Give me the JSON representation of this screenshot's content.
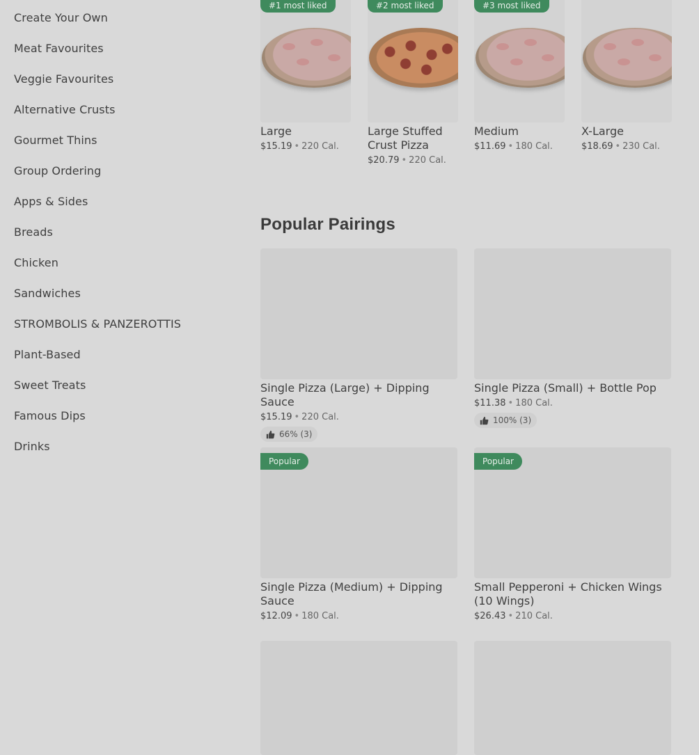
{
  "sidebar": {
    "items": [
      {
        "label": "Create Your Own"
      },
      {
        "label": "Meat Favourites"
      },
      {
        "label": "Veggie Favourites"
      },
      {
        "label": "Alternative Crusts"
      },
      {
        "label": "Gourmet Thins"
      },
      {
        "label": "Group Ordering"
      },
      {
        "label": "Apps & Sides"
      },
      {
        "label": "Breads"
      },
      {
        "label": "Chicken"
      },
      {
        "label": "Sandwiches"
      },
      {
        "label": "STROMBOLIS & PANZEROTTIS"
      },
      {
        "label": "Plant-Based"
      },
      {
        "label": "Sweet Treats"
      },
      {
        "label": "Famous Dips"
      },
      {
        "label": "Drinks"
      }
    ]
  },
  "carousel": {
    "items": [
      {
        "badge": "#1 most liked",
        "name": "Large",
        "price": "$15.19",
        "cal": "220 Cal."
      },
      {
        "badge": "#2 most liked",
        "name": "Large Stuffed Crust Pizza",
        "price": "$20.79",
        "cal": "220 Cal."
      },
      {
        "badge": "#3 most liked",
        "name": "Medium",
        "price": "$11.69",
        "cal": "180 Cal."
      },
      {
        "badge": "",
        "name": "X-Large",
        "price": "$18.69",
        "cal": "230 Cal."
      }
    ]
  },
  "pairings": {
    "title": "Popular Pairings",
    "items": [
      {
        "name": "Single Pizza (Large) + Dipping Sauce",
        "price": "$15.19",
        "cal": "220 Cal.",
        "likes": "66% (3)",
        "badge": ""
      },
      {
        "name": "Single Pizza (Small) + Bottle Pop",
        "price": "$11.38",
        "cal": "180 Cal.",
        "likes": "100% (3)",
        "badge": ""
      },
      {
        "name": "Single Pizza (Medium) + Dipping Sauce",
        "price": "$12.09",
        "cal": "180 Cal.",
        "likes": "",
        "badge": "Popular"
      },
      {
        "name": "Small Pepperoni + Chicken Wings (10 Wings)",
        "price": "$26.43",
        "cal": "210 Cal.",
        "likes": "",
        "badge": "Popular"
      }
    ]
  },
  "meta_separator": "•"
}
